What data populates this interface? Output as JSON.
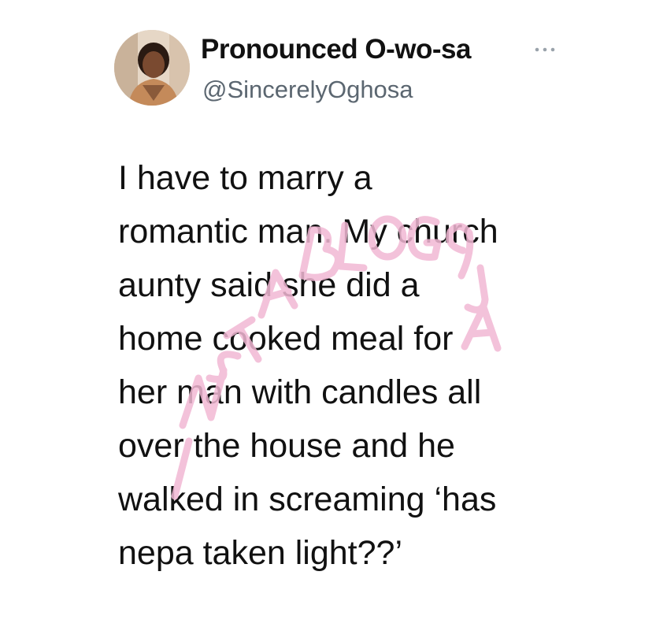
{
  "tweet": {
    "display_name": "Pronounced O-wo-sa",
    "handle": "@SincerelyOghosa",
    "text": "I have to marry a\nromantic man. My church\naunty said she did a\nhome cooked meal for\nher man with candles all\nover the house and he\nwalked in screaming ‘has\nnepa taken light??’"
  },
  "icons": {
    "more": "more-horizontal-icon",
    "avatar": "profile-photo"
  },
  "watermark": {
    "text": "INSTABLOG9JA",
    "color": "#f2b8d4"
  },
  "colors": {
    "name": "#111111",
    "handle": "#5b6670",
    "body_text": "#111111",
    "background": "#ffffff"
  }
}
